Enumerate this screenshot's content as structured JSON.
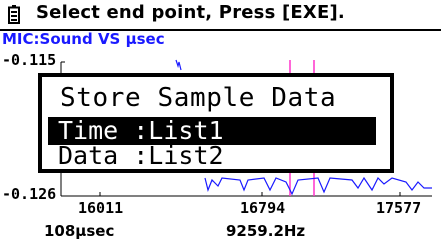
{
  "status_bar": {
    "icon": "battery-icon",
    "message": "Select end point, Press [EXE]."
  },
  "graph": {
    "title": "MIC:Sound VS µsec",
    "y_max_label": "-0.115",
    "y_min_label": "-0.126",
    "x_tick_labels": [
      "16011",
      "16794",
      "17577"
    ],
    "bottom_left": "108µsec",
    "bottom_right": "9259.2Hz"
  },
  "dialog": {
    "title": "Store Sample Data",
    "items": [
      {
        "label": "Time :List1",
        "selected": true
      },
      {
        "label": "Data :List2",
        "selected": false
      }
    ]
  },
  "colors": {
    "title": "#1a1aff",
    "waveform": "#1a1aff",
    "cursor": "#ff33cc"
  }
}
